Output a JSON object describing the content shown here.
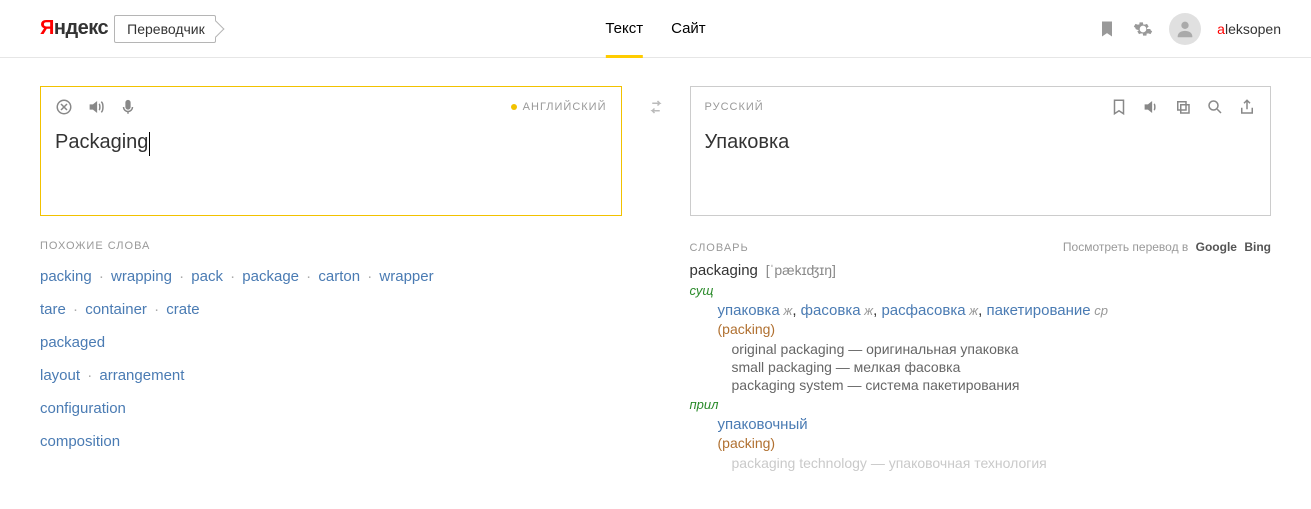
{
  "header": {
    "brand": "Яндекс",
    "service": "Переводчик",
    "nav": {
      "text": "Текст",
      "site": "Сайт"
    },
    "username": "aleksopen"
  },
  "source": {
    "lang": "АНГЛИЙСКИЙ",
    "text": "Packaging"
  },
  "target": {
    "lang": "РУССКИЙ",
    "text": "Упаковка"
  },
  "similar": {
    "title": "ПОХОЖИЕ СЛОВА",
    "rows": [
      [
        "packing",
        "wrapping",
        "pack",
        "package",
        "carton",
        "wrapper"
      ],
      [
        "tare",
        "container",
        "crate"
      ],
      [
        "packaged"
      ],
      [
        "layout",
        "arrangement"
      ],
      [
        "configuration"
      ],
      [
        "composition"
      ]
    ]
  },
  "dict": {
    "title": "СЛОВАРЬ",
    "lookup_label": "Посмотреть перевод в",
    "lookup_links": [
      "Google",
      "Bing"
    ],
    "word": "packaging",
    "ipa": "[ˈpækɪʤɪŋ]",
    "entries": [
      {
        "pos": "сущ",
        "translations": [
          {
            "word": "упаковка",
            "gender": "ж"
          },
          {
            "word": "фасовка",
            "gender": "ж"
          },
          {
            "word": "расфасовка",
            "gender": "ж"
          },
          {
            "word": "пакетирование",
            "gender": "ср"
          }
        ],
        "bracket": "(packing)",
        "examples": [
          {
            "en": "original packaging",
            "ru": "оригинальная упаковка"
          },
          {
            "en": "small packaging",
            "ru": "мелкая фасовка"
          },
          {
            "en": "packaging system",
            "ru": "система пакетирования"
          }
        ]
      },
      {
        "pos": "прил",
        "translations": [
          {
            "word": "упаковочный",
            "gender": ""
          }
        ],
        "bracket": "(packing)",
        "examples": [
          {
            "en": "packaging technology",
            "ru": "упаковочная технология"
          }
        ]
      }
    ]
  }
}
